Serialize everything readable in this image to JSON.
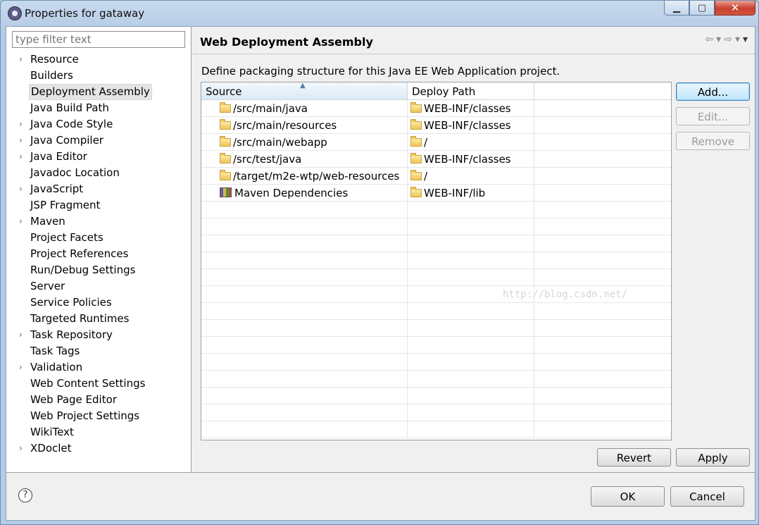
{
  "window": {
    "title": "Properties for gataway",
    "minimize_glyph": "▁",
    "maximize_glyph": "▢",
    "close_glyph": "✕"
  },
  "sidebar": {
    "filter_placeholder": "type filter text",
    "items": [
      {
        "label": "Resource",
        "expandable": true
      },
      {
        "label": "Builders",
        "expandable": false
      },
      {
        "label": "Deployment Assembly",
        "expandable": false,
        "selected": true
      },
      {
        "label": "Java Build Path",
        "expandable": false
      },
      {
        "label": "Java Code Style",
        "expandable": true
      },
      {
        "label": "Java Compiler",
        "expandable": true
      },
      {
        "label": "Java Editor",
        "expandable": true
      },
      {
        "label": "Javadoc Location",
        "expandable": false
      },
      {
        "label": "JavaScript",
        "expandable": true
      },
      {
        "label": "JSP Fragment",
        "expandable": false
      },
      {
        "label": "Maven",
        "expandable": true
      },
      {
        "label": "Project Facets",
        "expandable": false
      },
      {
        "label": "Project References",
        "expandable": false
      },
      {
        "label": "Run/Debug Settings",
        "expandable": false
      },
      {
        "label": "Server",
        "expandable": false
      },
      {
        "label": "Service Policies",
        "expandable": false
      },
      {
        "label": "Targeted Runtimes",
        "expandable": false
      },
      {
        "label": "Task Repository",
        "expandable": true
      },
      {
        "label": "Task Tags",
        "expandable": false
      },
      {
        "label": "Validation",
        "expandable": true
      },
      {
        "label": "Web Content Settings",
        "expandable": false
      },
      {
        "label": "Web Page Editor",
        "expandable": false
      },
      {
        "label": "Web Project Settings",
        "expandable": false
      },
      {
        "label": "WikiText",
        "expandable": false
      },
      {
        "label": "XDoclet",
        "expandable": true
      }
    ]
  },
  "main": {
    "title": "Web Deployment Assembly",
    "description": "Define packaging structure for this Java EE Web Application project.",
    "table": {
      "columns": [
        "Source",
        "Deploy Path",
        ""
      ],
      "rows": [
        {
          "source": "/src/main/java",
          "deploy_path": "WEB-INF/classes",
          "icon": "folder-icon"
        },
        {
          "source": "/src/main/resources",
          "deploy_path": "WEB-INF/classes",
          "icon": "folder-icon"
        },
        {
          "source": "/src/main/webapp",
          "deploy_path": "/",
          "icon": "folder-icon"
        },
        {
          "source": "/src/test/java",
          "deploy_path": "WEB-INF/classes",
          "icon": "folder-icon"
        },
        {
          "source": "/target/m2e-wtp/web-resources",
          "deploy_path": "/",
          "icon": "folder-icon"
        },
        {
          "source": "Maven Dependencies",
          "deploy_path": "WEB-INF/lib",
          "icon": "library-icon"
        }
      ],
      "empty_rows": 14
    },
    "buttons": {
      "add": "Add...",
      "edit": "Edit...",
      "remove": "Remove",
      "revert": "Revert",
      "apply": "Apply"
    },
    "watermark": "http://blog.csdn.net/"
  },
  "footer": {
    "help_glyph": "?",
    "ok": "OK",
    "cancel": "Cancel"
  },
  "colors": {
    "primary_button_border": "#3c7fb1",
    "close_button": "#c7402c",
    "title_bar": "#c9daee"
  }
}
